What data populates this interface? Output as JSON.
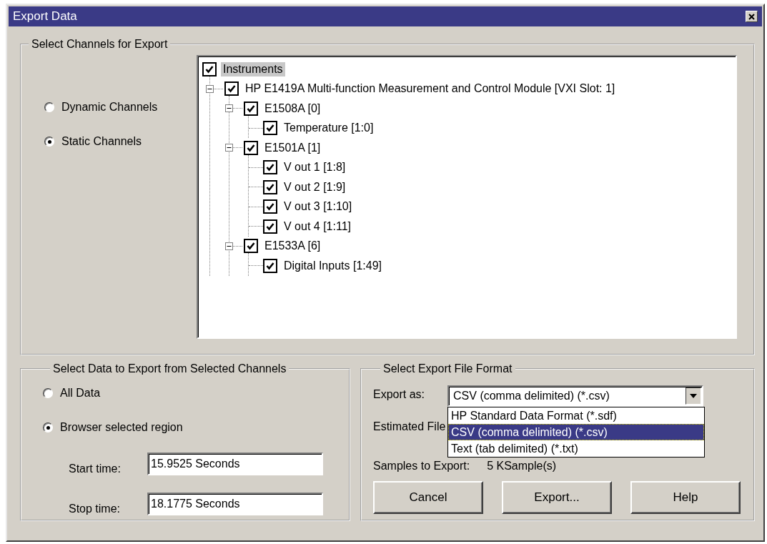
{
  "window": {
    "title": "Export Data"
  },
  "channels_group": {
    "title": "Select Channels for Export",
    "options": [
      {
        "label": "Dynamic Channels",
        "selected": false
      },
      {
        "label": "Static Channels",
        "selected": true
      }
    ],
    "tree": {
      "label": "Instruments",
      "checked": true,
      "selected": true,
      "children": [
        {
          "label": "HP E1419A Multi-function Measurement and Control Module [VXI Slot: 1]",
          "checked": true,
          "selected": false,
          "expanded": true,
          "children": [
            {
              "label": "E1508A [0]",
              "checked": true,
              "selected": false,
              "expanded": true,
              "children": [
                {
                  "label": "Temperature [1:0]",
                  "checked": true,
                  "selected": false
                }
              ]
            },
            {
              "label": "E1501A [1]",
              "checked": true,
              "selected": false,
              "expanded": true,
              "children": [
                {
                  "label": "V out 1 [1:8]",
                  "checked": true,
                  "selected": false
                },
                {
                  "label": "V out 2 [1:9]",
                  "checked": true,
                  "selected": false
                },
                {
                  "label": "V out 3 [1:10]",
                  "checked": true,
                  "selected": false
                },
                {
                  "label": "V out 4 [1:11]",
                  "checked": true,
                  "selected": false
                }
              ]
            },
            {
              "label": "E1533A [6]",
              "checked": true,
              "selected": false,
              "expanded": true,
              "children": [
                {
                  "label": "Digital Inputs [1:49]",
                  "checked": true,
                  "selected": false
                }
              ]
            }
          ]
        }
      ]
    }
  },
  "data_group": {
    "title": "Select Data to Export from Selected Channels",
    "options": [
      {
        "label": "All Data",
        "selected": false
      },
      {
        "label": "Browser selected region",
        "selected": true
      }
    ],
    "fields": [
      {
        "label": "Start time:",
        "value": "15.9525 Seconds"
      },
      {
        "label": "Stop time:",
        "value": "18.1775 Seconds"
      }
    ]
  },
  "format_group": {
    "title": "Select Export File Format",
    "export_as": {
      "label": "Export as:",
      "value": "CSV (comma delimited) (*.csv)",
      "open": true,
      "options": [
        {
          "label": "HP Standard Data Format (*.sdf)",
          "selected": false
        },
        {
          "label": "CSV (comma delimited) (*.csv)",
          "selected": true
        },
        {
          "label": "Text (tab delimited) (*.txt)",
          "selected": false
        }
      ]
    },
    "estimated_label": "Estimated File",
    "samples": {
      "label": "Samples to Export:",
      "value": "5 KSample(s)"
    }
  },
  "buttons": [
    "Cancel",
    "Export...",
    "Help"
  ]
}
